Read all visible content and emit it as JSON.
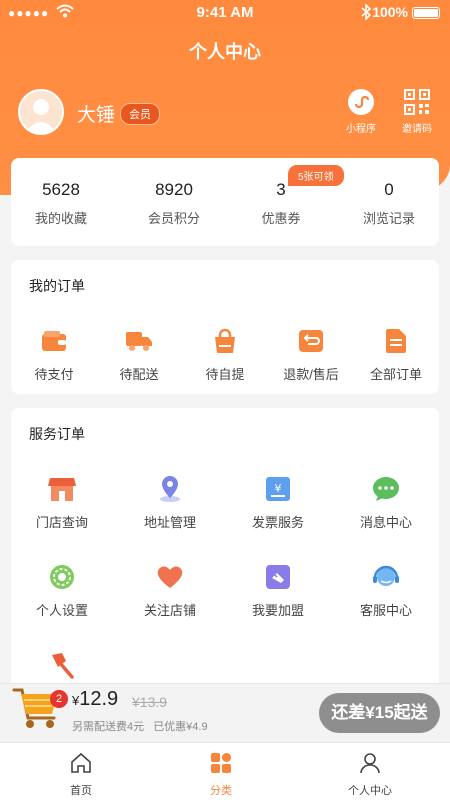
{
  "status_bar": {
    "time": "9:41 AM",
    "battery": "100%"
  },
  "nav": {
    "title": "个人中心"
  },
  "profile": {
    "name": "大锤",
    "badge": "会员"
  },
  "top_actions": [
    {
      "label": "小程序",
      "icon": "mini-program-icon"
    },
    {
      "label": "邀请码",
      "icon": "qr-code-icon"
    }
  ],
  "stats": [
    {
      "value": "5628",
      "label": "我的收藏"
    },
    {
      "value": "8920",
      "label": "会员积分"
    },
    {
      "value": "3",
      "label": "优惠券"
    },
    {
      "value": "0",
      "label": "浏览记录"
    }
  ],
  "coupon_tag": "5张可领",
  "orders": {
    "title": "我的订单",
    "items": [
      {
        "label": "待支付",
        "icon": "wallet-icon"
      },
      {
        "label": "待配送",
        "icon": "truck-icon"
      },
      {
        "label": "待自提",
        "icon": "bag-icon"
      },
      {
        "label": "退款/售后",
        "icon": "refund-icon"
      },
      {
        "label": "全部订单",
        "icon": "document-icon"
      }
    ]
  },
  "services": {
    "title": "服务订单",
    "items": [
      {
        "label": "门店查询",
        "icon": "store-icon"
      },
      {
        "label": "地址管理",
        "icon": "location-icon"
      },
      {
        "label": "发票服务",
        "icon": "invoice-icon"
      },
      {
        "label": "消息中心",
        "icon": "chat-icon"
      },
      {
        "label": "个人设置",
        "icon": "settings-icon"
      },
      {
        "label": "关注店铺",
        "icon": "heart-icon"
      },
      {
        "label": "我要加盟",
        "icon": "handshake-icon"
      },
      {
        "label": "客服中心",
        "icon": "headset-icon"
      },
      {
        "label": "",
        "icon": "axe-icon"
      }
    ]
  },
  "cart": {
    "count": "2",
    "currency": "¥",
    "price": "12.9",
    "original_price": "¥13.9",
    "delivery_note": "另需配送费4元",
    "discount_note": "已优惠¥4.9",
    "checkout_label": "还差¥15起送"
  },
  "tabs": [
    {
      "label": "首页",
      "icon": "home-icon"
    },
    {
      "label": "分类",
      "icon": "category-icon",
      "active": true
    },
    {
      "label": "个人中心",
      "icon": "user-icon"
    }
  ],
  "colors": {
    "accent": "#f7853b",
    "header": "#ff8a3d",
    "checkout": "#8e8e8e"
  }
}
